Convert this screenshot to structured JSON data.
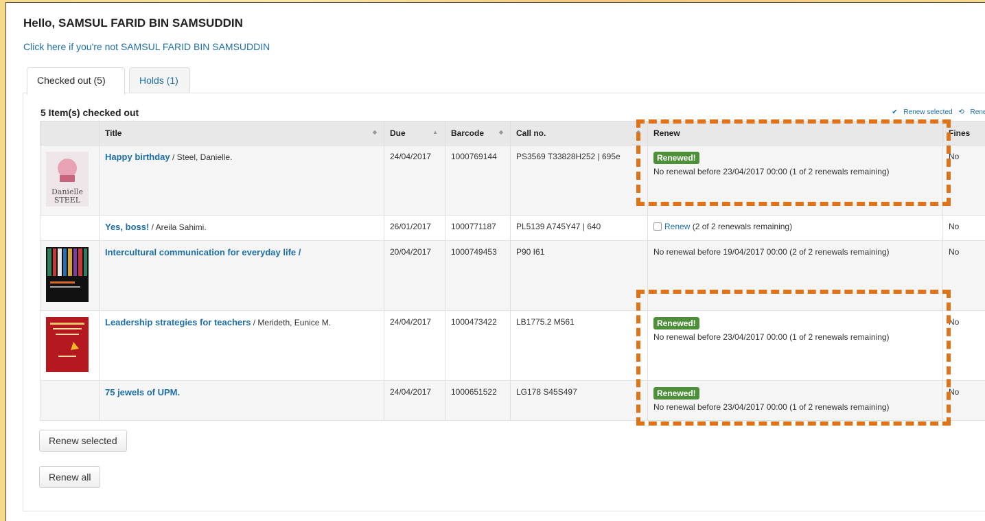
{
  "header": {
    "greeting": "Hello, SAMSUL FARID BIN SAMSUDDIN",
    "not_me_link": "Click here if you're not SAMSUL FARID BIN SAMSUDDIN"
  },
  "tabs": [
    {
      "label": "Checked out (5)",
      "active": true
    },
    {
      "label": "Holds (1)",
      "active": false
    }
  ],
  "panel": {
    "title": "5 Item(s) checked out",
    "renew_selected_link": "Renew selected",
    "renew_all_link": "Renew a"
  },
  "table": {
    "columns": [
      "Title",
      "Due",
      "Barcode",
      "Call no.",
      "Renew",
      "Fines"
    ],
    "rows": [
      {
        "title": "Happy birthday",
        "author": " / Steel, Danielle.",
        "due": "24/04/2017",
        "barcode": "1000769144",
        "callno": "PS3569 T33828H252 | 695e",
        "renewed": "Renewed!",
        "renew_note": "No renewal before 23/04/2017 00:00 (1 of 2 renewals remaining)",
        "fines": "No",
        "cover": "pink-book-cover"
      },
      {
        "title": "Yes, boss!",
        "author": " / Areila Sahimi.",
        "due": "26/01/2017",
        "barcode": "1000771187",
        "callno": "PL5139 A745Y47 | 640",
        "renew_link": "Renew",
        "renew_note": " (2 of 2 renewals remaining)",
        "fines": "No"
      },
      {
        "title": "Intercultural communication for everyday life /",
        "author": "",
        "due": "20/04/2017",
        "barcode": "1000749453",
        "callno": "P90 I61",
        "renew_note": "No renewal before 19/04/2017 00:00 (2 of 2 renewals remaining)",
        "fines": "No",
        "cover": "striped-book-cover"
      },
      {
        "title": "Leadership strategies for teachers",
        "author": " / Merideth, Eunice M.",
        "due": "24/04/2017",
        "barcode": "1000473422",
        "callno": "LB1775.2 M561",
        "renewed": "Renewed!",
        "renew_note": "No renewal before 23/04/2017 00:00 (1 of 2 renewals remaining)",
        "fines": "No",
        "cover": "red-book-cover"
      },
      {
        "title": "75 jewels of UPM.",
        "author": "",
        "due": "24/04/2017",
        "barcode": "1000651522",
        "callno": "LG178 S45S497",
        "renewed": "Renewed!",
        "renew_note": "No renewal before 23/04/2017 00:00 (1 of 2 renewals remaining)",
        "fines": "No"
      }
    ]
  },
  "buttons": {
    "renew_selected": "Renew selected",
    "renew_all": "Renew all"
  },
  "colors": {
    "link": "#1e6fa8",
    "renewed_badge": "#4e8f3a",
    "highlight": "#e07317"
  }
}
